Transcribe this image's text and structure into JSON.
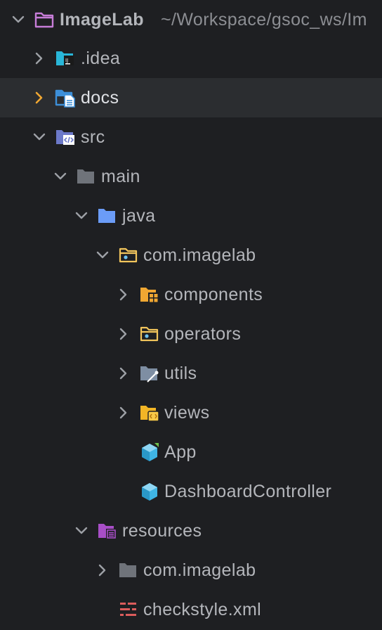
{
  "project": {
    "name": "ImageLab",
    "path": "~/Workspace/gsoc_ws/Im"
  },
  "tree": {
    "idea": ".idea",
    "docs": "docs",
    "src": "src",
    "main": "main",
    "java": "java",
    "package": "com.imagelab",
    "components": "components",
    "operators": "operators",
    "utils": "utils",
    "views": "views",
    "app": "App",
    "dashboard": "DashboardController",
    "resources": "resources",
    "res_package": "com.imagelab",
    "checkstyle": "checkstyle.xml"
  },
  "icons": {
    "root": "folder-icon",
    "idea": "intellij-folder-icon",
    "docs": "docs-folder-icon",
    "src": "source-folder-icon",
    "main": "folder-icon",
    "java": "java-folder-icon",
    "package": "package-icon",
    "components": "components-package-icon",
    "operators": "package-icon",
    "utils": "utils-package-icon",
    "views": "views-package-icon",
    "app": "javafx-app-class-icon",
    "dashboard": "class-icon",
    "resources": "resources-folder-icon",
    "res_package": "folder-icon",
    "checkstyle": "checkstyle-xml-icon"
  },
  "colors": {
    "background": "#1e1f22",
    "selected_row": "#2b2d30",
    "text": "#b4b6bb",
    "chevron_selected": "#f0a732",
    "folder_gray": "#6f737a",
    "java_blue": "#548af7",
    "package_yellow": "#f2c55c",
    "class_blue": "#3fb5e5",
    "resources_purple": "#a84ec7",
    "checkstyle_red": "#db5c5c"
  }
}
